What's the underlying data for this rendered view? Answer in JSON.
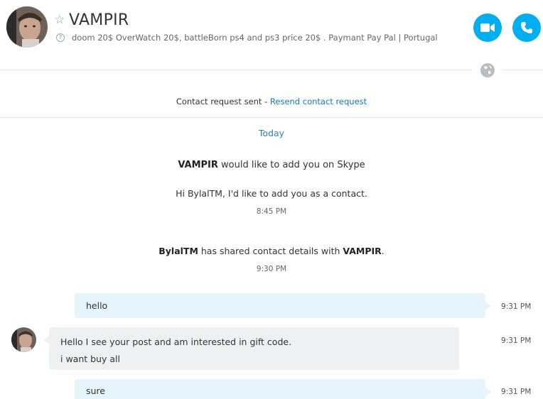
{
  "header": {
    "contact_name": "VAMPIR",
    "mood_message": "doom 20$ OverWatch 20$, battleBorn ps4 and ps3 price 20$ . Paymant Pay Pal  |  Portugal",
    "video_call_icon": "video-camera-icon",
    "audio_call_icon": "phone-icon",
    "accent_color": "#00aff0"
  },
  "request_banner": {
    "text": "Contact request sent - ",
    "link": "Resend contact request"
  },
  "conversation": {
    "date_label": "Today",
    "system_1": {
      "name": "VAMPIR",
      "text": " would like to add you on Skype"
    },
    "system_2": "Hi BylalTM, I'd like to add you as a contact.",
    "time_1": "8:45 PM",
    "system_3": {
      "name1": "BylalTM",
      "mid": " has shared contact details with ",
      "name2": "VAMPIR",
      "end": "."
    },
    "time_2": "9:30 PM",
    "messages": [
      {
        "direction": "outgoing",
        "lines": [
          "hello"
        ],
        "time": "9:31 PM"
      },
      {
        "direction": "incoming",
        "lines": [
          "Hello I see your post and am interested in gift code.",
          "i want buy all"
        ],
        "time": "9:31 PM"
      },
      {
        "direction": "outgoing",
        "lines": [
          "sure"
        ],
        "time": "9:31 PM"
      }
    ]
  }
}
